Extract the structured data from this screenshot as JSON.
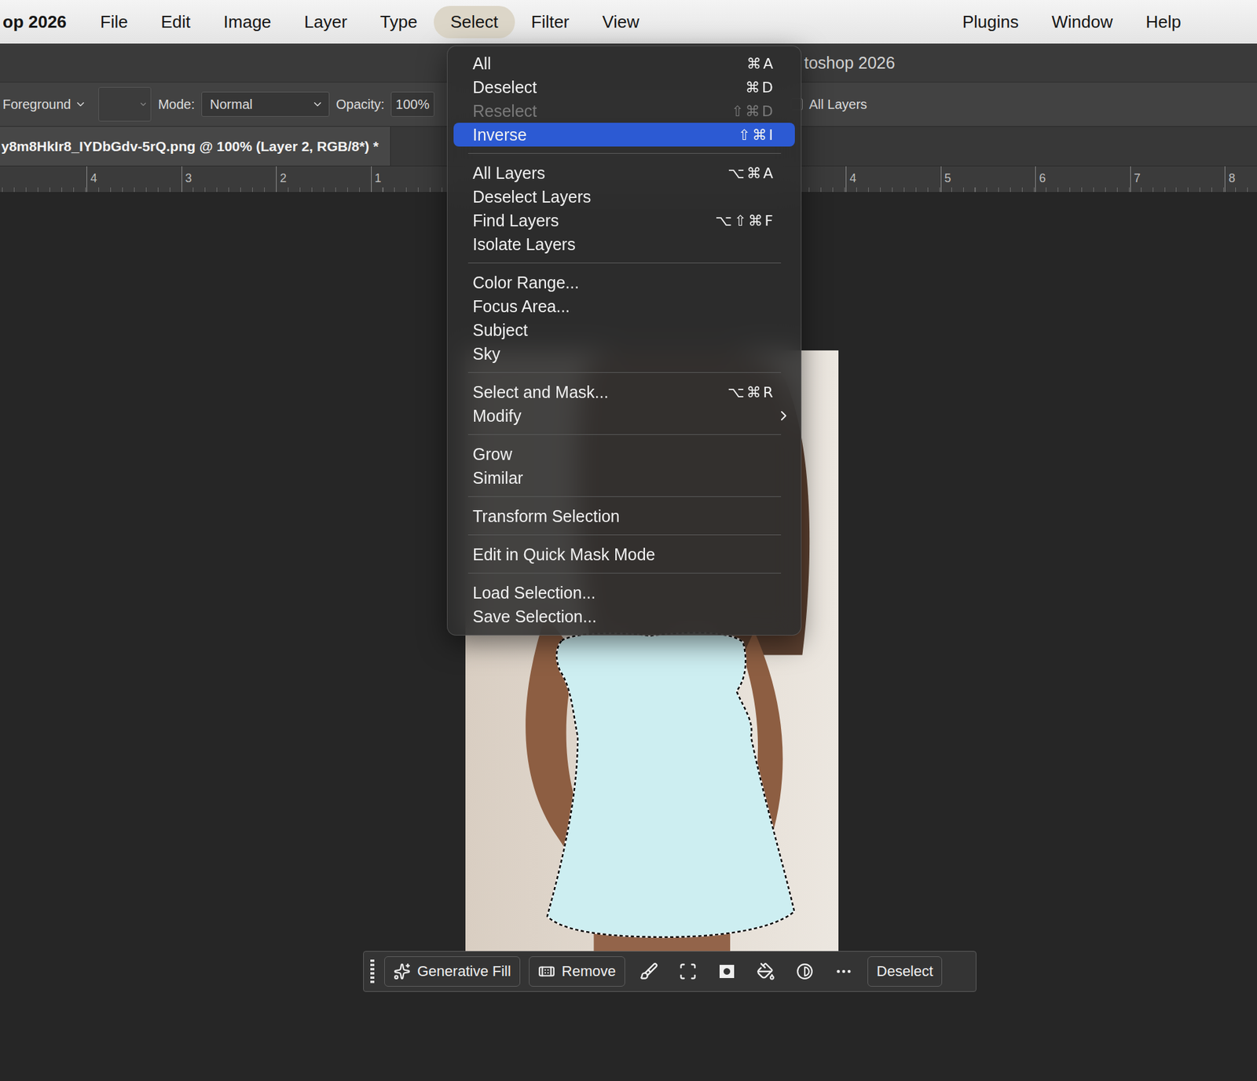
{
  "app_menu_bar": {
    "app_name": "op 2026",
    "items": [
      {
        "label": "File",
        "selected": false
      },
      {
        "label": "Edit",
        "selected": false
      },
      {
        "label": "Image",
        "selected": false
      },
      {
        "label": "Layer",
        "selected": false
      },
      {
        "label": "Type",
        "selected": false
      },
      {
        "label": "Select",
        "selected": true
      },
      {
        "label": "Filter",
        "selected": false
      },
      {
        "label": "View",
        "selected": false
      }
    ],
    "right_items": [
      {
        "label": "Plugins",
        "selected": false
      },
      {
        "label": "Window",
        "selected": false
      },
      {
        "label": "Help",
        "selected": false
      }
    ]
  },
  "window": {
    "title": "toshop 2026"
  },
  "options_bar": {
    "fill": "Foreground",
    "mode_label": "Mode:",
    "mode": "Normal",
    "opacity_label": "Opacity:",
    "opacity": "100%",
    "all_layers": {
      "label": "All Layers",
      "checked": false
    }
  },
  "document_tab": {
    "title": "y8m8HkIr8_IYDbGdv-5rQ.png @ 100% (Layer 2, RGB/8*) *"
  },
  "ruler": {
    "left": [
      "4",
      "3",
      "2",
      "1"
    ],
    "right": [
      "4",
      "5",
      "6",
      "7",
      "8"
    ]
  },
  "select_menu": {
    "groups": [
      {
        "items": [
          {
            "label": "All",
            "shortcut": "⌘A",
            "disabled": false,
            "highlighted": false,
            "submenu": false
          },
          {
            "label": "Deselect",
            "shortcut": "⌘D",
            "disabled": false,
            "highlighted": false,
            "submenu": false
          },
          {
            "label": "Reselect",
            "shortcut": "⇧⌘D",
            "disabled": true,
            "highlighted": false,
            "submenu": false
          },
          {
            "label": "Inverse",
            "shortcut": "⇧⌘I",
            "disabled": false,
            "highlighted": true,
            "submenu": false
          }
        ]
      },
      {
        "items": [
          {
            "label": "All Layers",
            "shortcut": "⌥⌘A",
            "disabled": false,
            "highlighted": false,
            "submenu": false
          },
          {
            "label": "Deselect Layers",
            "disabled": false,
            "highlighted": false,
            "submenu": false
          },
          {
            "label": "Find Layers",
            "shortcut": "⌥⇧⌘F",
            "disabled": false,
            "highlighted": false,
            "submenu": false
          },
          {
            "label": "Isolate Layers",
            "disabled": false,
            "highlighted": false,
            "submenu": false
          }
        ]
      },
      {
        "items": [
          {
            "label": "Color Range...",
            "disabled": false,
            "highlighted": false,
            "submenu": false
          },
          {
            "label": "Focus Area...",
            "disabled": false,
            "highlighted": false,
            "submenu": false
          },
          {
            "label": "Subject",
            "disabled": false,
            "highlighted": false,
            "submenu": false
          },
          {
            "label": "Sky",
            "disabled": false,
            "highlighted": false,
            "submenu": false
          }
        ]
      },
      {
        "items": [
          {
            "label": "Select and Mask...",
            "shortcut": "⌥⌘R",
            "disabled": false,
            "highlighted": false,
            "submenu": false
          },
          {
            "label": "Modify",
            "disabled": false,
            "highlighted": false,
            "submenu": true
          }
        ]
      },
      {
        "items": [
          {
            "label": "Grow",
            "disabled": false,
            "highlighted": false,
            "submenu": false
          },
          {
            "label": "Similar",
            "disabled": false,
            "highlighted": false,
            "submenu": false
          }
        ]
      },
      {
        "items": [
          {
            "label": "Transform Selection",
            "disabled": false,
            "highlighted": false,
            "submenu": false
          }
        ]
      },
      {
        "items": [
          {
            "label": "Edit in Quick Mask Mode",
            "disabled": false,
            "highlighted": false,
            "submenu": false
          }
        ]
      },
      {
        "items": [
          {
            "label": "Load Selection...",
            "disabled": false,
            "highlighted": false,
            "submenu": false
          },
          {
            "label": "Save Selection...",
            "disabled": false,
            "highlighted": false,
            "submenu": false
          }
        ]
      }
    ]
  },
  "contextual_task_bar": {
    "generative_fill": "Generative Fill",
    "remove": "Remove",
    "deselect": "Deselect"
  }
}
